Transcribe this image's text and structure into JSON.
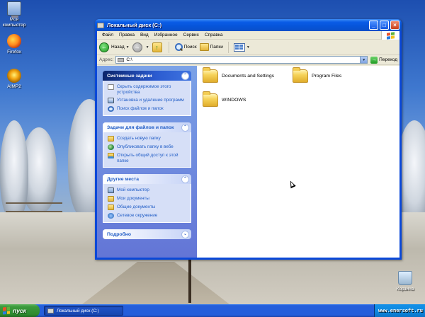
{
  "desktop": {
    "icons": [
      {
        "label_line1": "Мой",
        "label_line2": "компьютер",
        "icon": "my-computer-icon"
      },
      {
        "label_line1": "Firefox",
        "label_line2": "",
        "icon": "firefox-icon"
      },
      {
        "label_line1": "AIMP2",
        "label_line2": "",
        "icon": "aimp-icon"
      },
      {
        "label_line1": "Корзина",
        "label_line2": "",
        "icon": "recycle-bin-icon"
      }
    ],
    "watermark": "www.enersoft.ru"
  },
  "window": {
    "title": "Локальный диск (C:)",
    "controls": {
      "minimize": "_",
      "maximize": "□",
      "close": "×"
    },
    "menu": [
      "Файл",
      "Правка",
      "Вид",
      "Избранное",
      "Сервис",
      "Справка"
    ],
    "toolbar": {
      "back_label": "Назад",
      "search_label": "Поиск",
      "folders_label": "Папки"
    },
    "address": {
      "label": "Адрес:",
      "value": "C:\\",
      "go_label": "Переход"
    },
    "taskpane": {
      "system_tasks": {
        "title": "Системные задачи",
        "items": [
          {
            "label": "Скрыть содержимое этого устройства",
            "icon": "hide-icon"
          },
          {
            "label": "Установка и удаление программ",
            "icon": "add-remove-icon"
          },
          {
            "label": "Поиск файлов и папок",
            "icon": "search-icon"
          }
        ]
      },
      "file_tasks": {
        "title": "Задачи для файлов и папок",
        "items": [
          {
            "label": "Создать новую папку",
            "icon": "new-folder-icon"
          },
          {
            "label": "Опубликовать папку в вебе",
            "icon": "publish-web-icon"
          },
          {
            "label": "Открыть общий доступ к этой папке",
            "icon": "share-folder-icon"
          }
        ]
      },
      "other_places": {
        "title": "Другие места",
        "items": [
          {
            "label": "Мой компьютер",
            "icon": "my-computer-icon"
          },
          {
            "label": "Мои документы",
            "icon": "my-documents-icon"
          },
          {
            "label": "Общие документы",
            "icon": "shared-documents-icon"
          },
          {
            "label": "Сетевое окружение",
            "icon": "network-icon"
          }
        ]
      },
      "details": {
        "title": "Подробно"
      }
    },
    "folders": [
      {
        "name": "Documents and Settings"
      },
      {
        "name": "Program Files"
      },
      {
        "name": "WINDOWS"
      }
    ]
  },
  "taskbar": {
    "start_label": "пуск",
    "open_window": "Локальный диск (C:)"
  }
}
